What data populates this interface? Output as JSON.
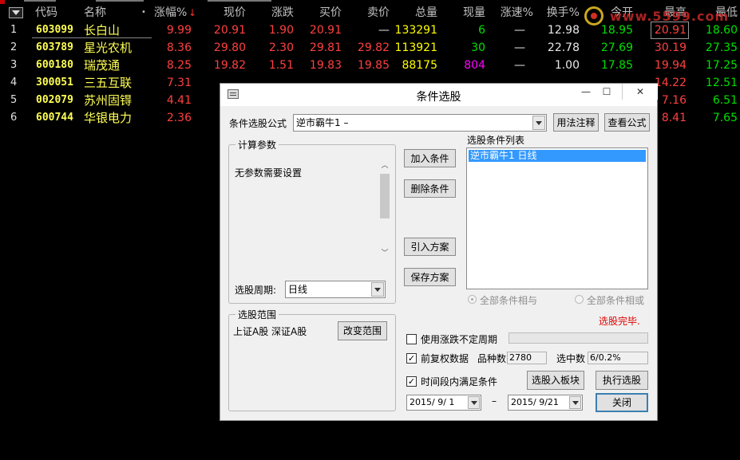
{
  "table": {
    "headers": {
      "code": "代码",
      "name": "名称",
      "dot": "•",
      "change_pct": "涨幅%",
      "price": "现价",
      "change": "涨跌",
      "bid": "买价",
      "ask": "卖价",
      "volume": "总量",
      "cur_vol": "现量",
      "speed": "涨速%",
      "turnover": "换手%",
      "open": "今开",
      "high": "最高",
      "low": "最低"
    },
    "sort_icon": "arrow-down-icon",
    "rows": [
      {
        "idx": "1",
        "code": "603099",
        "name": "长白山",
        "change_pct": "9.99",
        "price": "20.91",
        "change": "1.90",
        "bid": "20.91",
        "ask": "—",
        "volume": "133291",
        "cur_vol": "6",
        "speed": "—",
        "turnover": "12.98",
        "open": "18.95",
        "high": "20.91",
        "low": "18.60"
      },
      {
        "idx": "2",
        "code": "603789",
        "name": "星光农机",
        "change_pct": "8.36",
        "price": "29.80",
        "change": "2.30",
        "bid": "29.81",
        "ask": "29.82",
        "volume": "113921",
        "cur_vol": "30",
        "speed": "—",
        "turnover": "22.78",
        "open": "27.69",
        "high": "30.19",
        "low": "27.35"
      },
      {
        "idx": "3",
        "code": "600180",
        "name": "瑞茂通",
        "change_pct": "8.25",
        "price": "19.82",
        "change": "1.51",
        "bid": "19.83",
        "ask": "19.85",
        "volume": "88175",
        "cur_vol": "804",
        "speed": "—",
        "turnover": "1.00",
        "open": "17.85",
        "high": "19.94",
        "low": "17.25"
      },
      {
        "idx": "4",
        "code": "300051",
        "name": "三五互联",
        "change_pct": "7.31",
        "price": "",
        "change": "",
        "bid": "",
        "ask": "",
        "volume": "",
        "cur_vol": "",
        "speed": "",
        "turnover": "",
        "open": "",
        "high": "14.22",
        "low": "12.51"
      },
      {
        "idx": "5",
        "code": "002079",
        "name": "苏州固锝",
        "change_pct": "4.41",
        "price": "",
        "change": "",
        "bid": "",
        "ask": "",
        "volume": "",
        "cur_vol": "",
        "speed": "",
        "turnover": "",
        "open": "",
        "high": "7.16",
        "low": "6.51"
      },
      {
        "idx": "6",
        "code": "600744",
        "name": "华银电力",
        "change_pct": "2.36",
        "price": "",
        "change": "",
        "bid": "",
        "ask": "",
        "volume": "",
        "cur_vol": "",
        "speed": "",
        "turnover": "",
        "open": "",
        "high": "8.41",
        "low": "7.65"
      }
    ]
  },
  "watermark": {
    "icon": "site-logo-icon",
    "text": "www.5599.com"
  },
  "colors": {
    "up": "#ff4040",
    "down": "#00e000",
    "code": "#ffff54",
    "status": "#e00000",
    "selection": "#3399ff"
  },
  "dialog": {
    "title": "条件选股",
    "window_buttons": {
      "minimize": "—",
      "maximize": "☐",
      "close": "✕"
    },
    "formula_label": "条件选股公式",
    "formula_value": "逆市霸牛1      –",
    "usage_button": "用法注释",
    "view_button": "查看公式",
    "params_group": "计算参数",
    "params_text": "无参数需要设置",
    "period_label": "选股周期:",
    "period_value": "日线",
    "add_button": "加入条件",
    "delete_button": "删除条件",
    "import_button": "引入方案",
    "save_button": "保存方案",
    "conditions_label": "选股条件列表",
    "conditions": [
      "逆市霸牛1   日线"
    ],
    "radio_and": "全部条件相与",
    "radio_or": "全部条件相或",
    "status": "选股完毕.",
    "scope_group": "选股范围",
    "scope_text": "上证A股  深证A股",
    "change_scope_button": "改变范围",
    "use_variable_period": "使用涨跌不定周期",
    "pre_adjust_label": "前复权数据",
    "pre_adjust_checked": "✓",
    "count_label": "品种数",
    "count_value": "2780",
    "selected_label": "选中数",
    "selected_value": "6/0.2%",
    "progress": 0,
    "time_range_label": "时间段内满足条件",
    "time_range_checked": "✓",
    "to_board_button": "选股入板块",
    "execute_button": "执行选股",
    "date_from": "2015/ 9/ 1",
    "date_sep": "–",
    "date_to": "2015/ 9/21",
    "close_button": "关闭"
  }
}
